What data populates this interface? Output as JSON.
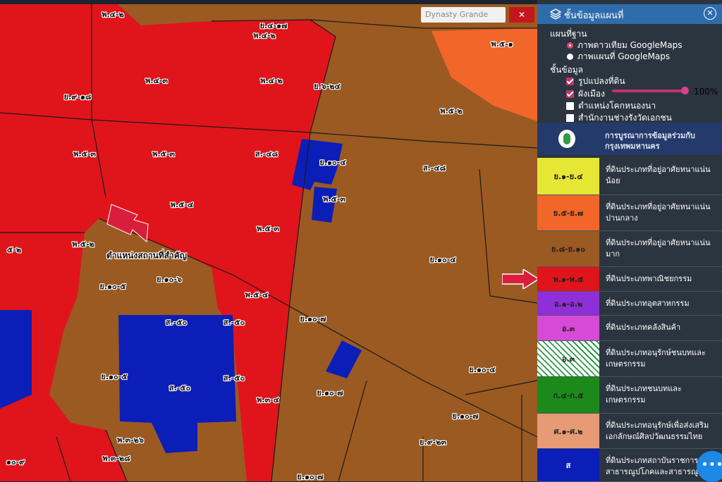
{
  "search": {
    "placeholder": "Dynasty Grande"
  },
  "panel": {
    "title": "ชั้นข้อมูลแผนที่",
    "base_heading": "แผนที่ฐาน",
    "base_options": [
      {
        "label": "ภาพดาวเทียม GoogleMaps",
        "selected": true
      },
      {
        "label": "ภาพแผนที่ GoogleMaps",
        "selected": false
      }
    ],
    "layers_heading": "ชั้นข้อมูล",
    "layers": [
      {
        "label": "รูปแปลงที่ดิน",
        "checked": true
      },
      {
        "label": "ผังเมือง",
        "checked": true
      },
      {
        "label": "ตำแหน่งโคกหนองนา",
        "checked": false
      },
      {
        "label": "สำนักงานช่างรังวัดเอกชน",
        "checked": false
      }
    ],
    "opacity": "100%",
    "opacity_value": 1.0,
    "bma_line1": "การบูรณาการข้อมูลร่วมกับ",
    "bma_line2": "กรุงเทพมหานคร"
  },
  "legend": [
    {
      "code": "ย.๑-ย.๔",
      "text": "ที่ดินประเภทที่อยู่อาศัยหนาแน่นน้อย",
      "color": "#e6e635",
      "fg": "#222"
    },
    {
      "code": "ย.๕-ย.๗",
      "text": "ที่ดินประเภทที่อยู่อาศัยหนาแน่นปานกลาง",
      "color": "#f2662a",
      "fg": "#222"
    },
    {
      "code": "ย.๘-ย.๑๐",
      "text": "ที่ดินประเภทที่อยู่อาศัยหนาแน่นมาก",
      "color": "#9b5a22",
      "fg": "#222"
    },
    {
      "code": "พ.๑-พ.๕",
      "text": "ที่ดินประเภทพาณิชยกรรม",
      "color": "#e0141b",
      "fg": "#222"
    },
    {
      "code": "อ.๑-อ.๒",
      "text": "ที่ดินประเภทอุตสาหกรรม",
      "color": "#8e2fd8",
      "fg": "#222"
    },
    {
      "code": "อ.๓",
      "text": "ที่ดินประเภทคลังสินค้า",
      "color": "#d64ad8",
      "fg": "#222"
    },
    {
      "code": "อ.๓",
      "text": "ที่ดินประเภทอนุรักษ์ชนบทและเกษตรกรรม",
      "color": "hatch",
      "fg": "#222"
    },
    {
      "code": "ก.๔-ก.๕",
      "text": "ที่ดินประเภทชนบทและเกษตรกรรม",
      "color": "#1b8a1b",
      "fg": "#222"
    },
    {
      "code": "ศ.๑-ศ.๒",
      "text": "ที่ดินประเภทอนุรักษ์เพื่อส่งเสริมเอกลักษณ์ศิลปวัฒนธรรมไทย",
      "color": "#e79b74",
      "fg": "#222"
    },
    {
      "code": "ส",
      "text": "ที่ดินประเภทสถาบันราชการ สาธารณูปโภคและสาธารณูปการ",
      "color": "#0c1eb8",
      "fg": "#fff"
    }
  ],
  "map": {
    "colors": {
      "commercial": "#e0141b",
      "residential_high": "#9b5a22",
      "institution": "#0c1eb8",
      "residential_mid": "#f2662a"
    },
    "landmark_label": "ตำแหน่งสถานที่สำคัญ",
    "labels": [
      "พ.๔-๒",
      "ย.๔-๑๗",
      "พ.๔-๒",
      "พ.๔-๒",
      "พ.๔-๓",
      "ย.๖-๒๔",
      "พ.๕-๑",
      "ย.๙-๑๘",
      "พ.๕-๒",
      "พ.๕-๓",
      "พ.๕-๓",
      "ส.-๔๘",
      "ย.๑๐-๔",
      "ส.-๔๘",
      "พ.๕-๓",
      "พ.๕-๔",
      "พ.๕-๓",
      "๕-๒",
      "พ.๕-๒",
      "ย.๑๐-๕",
      "ย.๑๐-๖",
      "ย.๑๐-๔",
      "พ.๕-๔",
      "ส.-๕๐",
      "ส.-๕๐",
      "ย.๑๐-๗",
      "ย.๑๐-๕",
      "ส.-๕๐",
      "ส.-๕๐",
      "ย.๑๐-๔",
      "ย.๑๐-๗",
      "พ.๓-๔",
      "ย.๑๐-๗",
      "พ.๓-๒๖",
      "ย.๙-๒๓",
      "พ.๓-๒๘",
      "๑๐-๙",
      "ย.๑๐-๗"
    ]
  }
}
